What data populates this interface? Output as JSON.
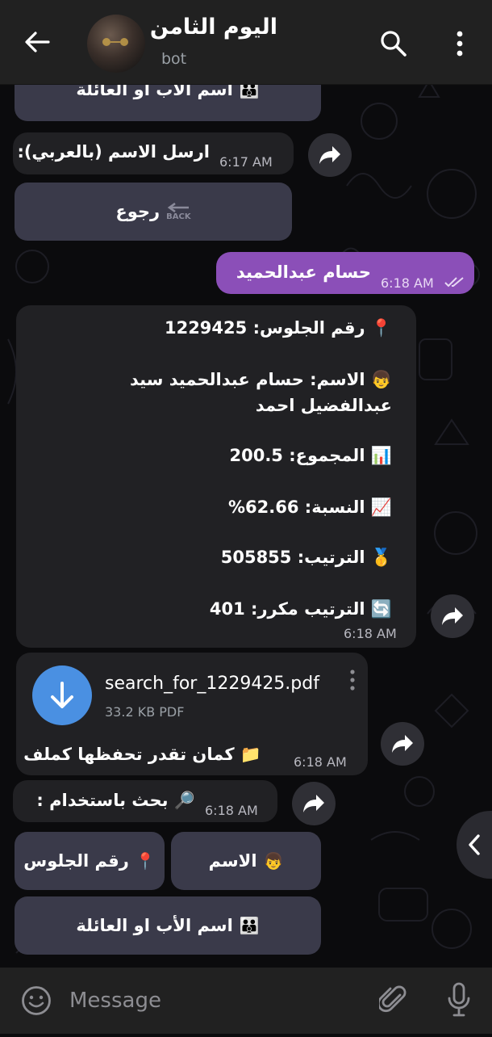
{
  "header": {
    "title": "اليوم الثامن",
    "subtitle": "bot",
    "icons": [
      "back-arrow-icon",
      "search-icon",
      "more-vertical-icon"
    ]
  },
  "keyboard_top": {
    "parent_name_button": "اسم الأب او العائلة",
    "parent_name_emoji": "👪"
  },
  "messages": {
    "prompt_name": {
      "text": "ارسل الاسم (بالعربي):",
      "time": "6:17 AM"
    },
    "back_button": {
      "label": "رجوع",
      "icon_text": "BACK"
    },
    "user_reply": {
      "text": "حسام عبدالحميد",
      "time": "6:18 AM"
    },
    "result": {
      "seat": {
        "emoji": "📍",
        "label": "رقم الجلوس:",
        "value": "1229425"
      },
      "name": {
        "emoji": "👦",
        "label": "الاسم:",
        "value_line1": "حسام عبدالحميد سيد",
        "value_line2": "عبدالفضيل احمد"
      },
      "total": {
        "emoji": "📊",
        "label": "المجموع:",
        "value": "200.5"
      },
      "percent": {
        "emoji": "📈",
        "label": "النسبة:",
        "value": "62.66%"
      },
      "rank": {
        "emoji": "🥇",
        "label": "الترتيب:",
        "value": "505855"
      },
      "rank_dup": {
        "emoji": "🔄",
        "label": "الترتيب مكرر:",
        "value": "401"
      },
      "time": "6:18 AM"
    },
    "pdf": {
      "filename": "search_for_1229425.pdf",
      "meta": "33.2 KB PDF",
      "caption": "كمان تقدر تحفظها كملف",
      "caption_emoji": "📁",
      "time": "6:18 AM"
    },
    "search_by": {
      "text": "بحث باستخدام :",
      "emoji": "🔎",
      "time": "6:18 AM"
    }
  },
  "keyboard": {
    "name_button": "الاسم",
    "name_emoji": "👦",
    "seat_button": "رقم الجلوس",
    "seat_emoji": "📍",
    "parent_button": "اسم الأب او العائلة",
    "parent_emoji": "👪"
  },
  "composer": {
    "placeholder": "Message"
  },
  "colors": {
    "outgoing_bubble": "#8b4fb8",
    "incoming_bubble": "#212124",
    "keyboard_button": "#3a3a4a",
    "pdf_icon": "#4a90e2"
  }
}
